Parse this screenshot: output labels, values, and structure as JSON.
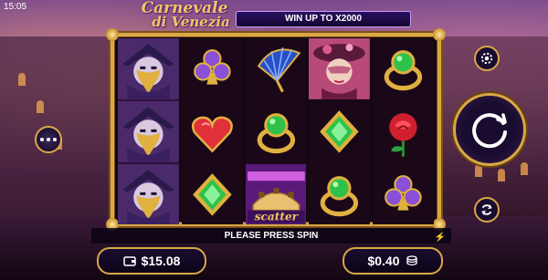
{
  "status_bar": {
    "time": "15:05"
  },
  "logo": {
    "line1": "Carnevale",
    "line2": "di Venezia"
  },
  "win_banner": {
    "text": "WIN UP TO X2000"
  },
  "reels": [
    [
      "masked-man",
      "masked-man",
      "masked-man"
    ],
    [
      "club-amethyst",
      "heart-ruby",
      "diamond-emerald"
    ],
    [
      "fan",
      "emerald-ring",
      "scatter-bridge"
    ],
    [
      "masked-lady",
      "diamond-emerald",
      "emerald-ring"
    ],
    [
      "emerald-ring",
      "rose",
      "club-amethyst"
    ]
  ],
  "scatter": {
    "label": "scatter"
  },
  "message": {
    "text": "PLEASE PRESS SPIN"
  },
  "balance": {
    "value": "$15.08",
    "icon": "wallet-icon"
  },
  "bet": {
    "value": "$0.40",
    "icon": "coins-icon"
  },
  "controls": {
    "menu_icon": "more-dots-icon",
    "settings_icon": "gear-icon",
    "spin_icon": "spin-arrow-icon",
    "autoplay_icon": "autoplay-icon"
  },
  "colors": {
    "gold": "#d9a845",
    "banner": "#1c0b45",
    "emerald": "#2fc24a",
    "ruby": "#e0303a",
    "amethyst": "#8a50d8"
  }
}
